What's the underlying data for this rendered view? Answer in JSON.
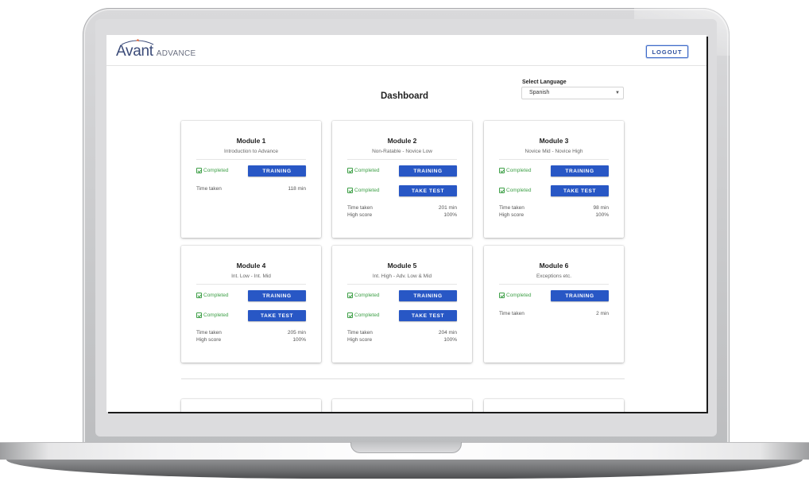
{
  "header": {
    "logo_main": "Avant",
    "logo_sub": "ADVANCE",
    "logout_label": "LOGOUT"
  },
  "page": {
    "title": "Dashboard"
  },
  "language": {
    "label": "Select Language",
    "selected": "Spanish"
  },
  "status_color": "#3fa048",
  "button_color": "#2857c5",
  "modules": [
    {
      "title": "Module 1",
      "subtitle": "Introduction to Advance",
      "training": {
        "status": "Completed",
        "label": "TRAINING"
      },
      "time_label": "Time taken",
      "time_value": "118 min"
    },
    {
      "title": "Module 2",
      "subtitle": "Non-Ratable - Novice Low",
      "training": {
        "status": "Completed",
        "label": "TRAINING"
      },
      "test": {
        "status": "Completed",
        "label": "TAKE TEST"
      },
      "time_label": "Time taken",
      "time_value": "201 min",
      "score_label": "High score",
      "score_value": "100%"
    },
    {
      "title": "Module 3",
      "subtitle": "Novice Mid - Novice High",
      "training": {
        "status": "Completed",
        "label": "TRAINING"
      },
      "test": {
        "status": "Completed",
        "label": "TAKE TEST"
      },
      "time_label": "Time taken",
      "time_value": "98 min",
      "score_label": "High score",
      "score_value": "100%"
    },
    {
      "title": "Module 4",
      "subtitle": "Int. Low - Int. Mid",
      "training": {
        "status": "Completed",
        "label": "TRAINING"
      },
      "test": {
        "status": "Completed",
        "label": "TAKE TEST"
      },
      "time_label": "Time taken",
      "time_value": "205 min",
      "score_label": "High score",
      "score_value": "100%"
    },
    {
      "title": "Module 5",
      "subtitle": "Int. High - Adv. Low & Mid",
      "training": {
        "status": "Completed",
        "label": "TRAINING"
      },
      "test": {
        "status": "Completed",
        "label": "TAKE TEST"
      },
      "time_label": "Time taken",
      "time_value": "204 min",
      "score_label": "High score",
      "score_value": "100%"
    },
    {
      "title": "Module 6",
      "subtitle": "Exceptions etc.",
      "training": {
        "status": "Completed",
        "label": "TRAINING"
      },
      "time_label": "Time taken",
      "time_value": "2 min"
    }
  ]
}
